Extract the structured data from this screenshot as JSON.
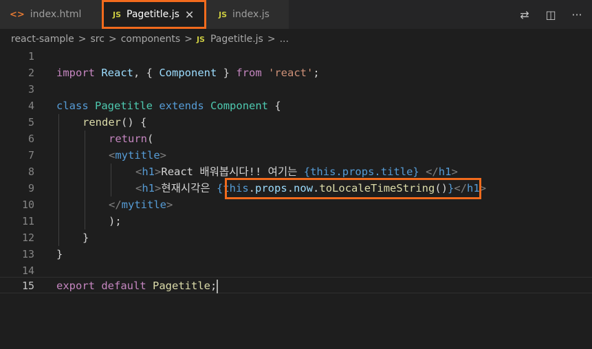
{
  "tabs": [
    {
      "icon": "<>",
      "label": "index.html"
    },
    {
      "icon": "JS",
      "label": "Pagetitle.js",
      "close": "✕"
    },
    {
      "icon": "JS",
      "label": "index.js"
    }
  ],
  "actions": {
    "compare": "⇄",
    "split": "◫",
    "more": "···"
  },
  "breadcrumb": {
    "items": [
      "react-sample",
      "src",
      "components"
    ],
    "file_icon": "JS",
    "file": "Pagetitle.js",
    "separator": ">",
    "ellipsis": "..."
  },
  "code": {
    "line_numbers": [
      "1",
      "2",
      "3",
      "4",
      "5",
      "6",
      "7",
      "8",
      "9",
      "10",
      "11",
      "12",
      "13",
      "14",
      "15"
    ],
    "l2": {
      "import": "import",
      "react": "React",
      "p1": ", { ",
      "component": "Component",
      "p2": " } ",
      "from": "from",
      "sp": " ",
      "module": "'react'",
      "semi": ";"
    },
    "l4": {
      "class": "class",
      "sp1": " ",
      "name": "Pagetitle",
      "sp2": " ",
      "extends": "extends",
      "sp3": " ",
      "base": "Component",
      "brace": " {"
    },
    "l5": {
      "fn": "render",
      "rest": "() {"
    },
    "l6": {
      "ret": "return",
      "paren": "("
    },
    "l7": {
      "lt": "<",
      "tag": "mytitle",
      "gt": ">"
    },
    "l8": {
      "lt": "<",
      "tag": "h1",
      "gt": ">",
      "text": "React 배워봅시다!! 여기는 ",
      "expr": "{this.props.title}",
      "sp": " ",
      "close_lt": "</",
      "close_tag": "h1",
      "close_gt": ">"
    },
    "l9": {
      "lt": "<",
      "tag": "h1",
      "gt": ">",
      "text": "현재시각은 ",
      "ob": "{",
      "this": "this",
      "d1": ".",
      "props": "props",
      "d2": ".",
      "now": "now",
      "d3": ".",
      "method": "toLocaleTimeString",
      "call": "()",
      "cb": "}",
      "close_lt": "</",
      "close_tag": "h1",
      "close_gt": ">"
    },
    "l10": {
      "close_lt": "</",
      "tag": "mytitle",
      "gt": ">"
    },
    "l11": {
      "text": ");"
    },
    "l12": {
      "text": "}"
    },
    "l13": {
      "text": "}"
    },
    "l15": {
      "export": "export",
      "sp1": " ",
      "default": "default",
      "sp2": " ",
      "name": "Pagetitle",
      "semi": ";"
    }
  }
}
